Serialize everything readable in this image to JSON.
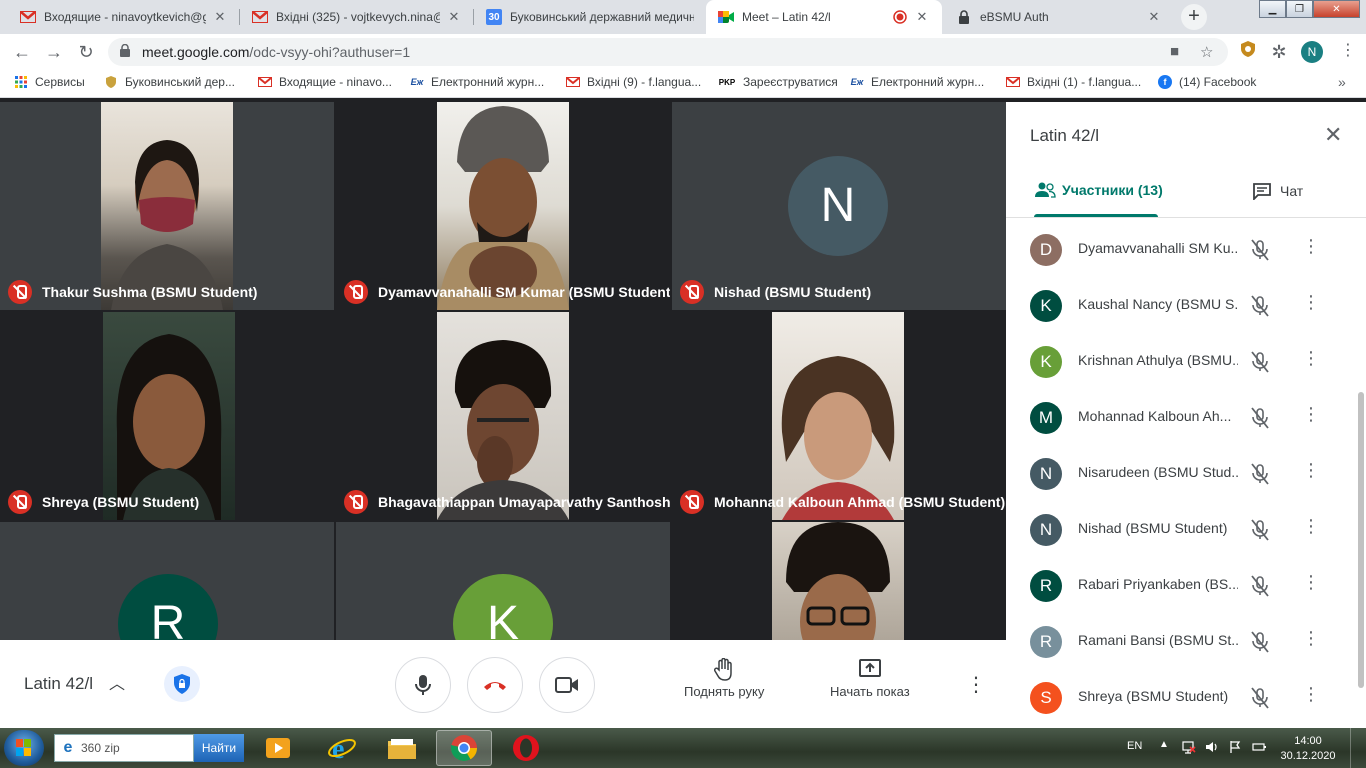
{
  "browser": {
    "tabs": [
      {
        "label": "Входящие - ninavoytkevich@gmail.com",
        "icon": "gmail-icon",
        "active": false
      },
      {
        "label": "Вхідні (325) - vojtkevych.nina@bsmu",
        "icon": "gmail-icon",
        "active": false
      },
      {
        "label": "Буковинський державний медичний",
        "icon": "calendar-icon",
        "active": false
      },
      {
        "label": "Meet – Latin 42/l",
        "icon": "meet-icon",
        "active": true
      },
      {
        "label": "eBSMU Auth",
        "icon": "lock-icon",
        "active": false
      }
    ],
    "url_host": "meet.google.com",
    "url_path": "/odc-vsyy-ohi?authuser=1",
    "profile_initial": "N",
    "bookmarks": [
      {
        "label": "Сервисы",
        "icon": "apps-grid-icon"
      },
      {
        "label": "Буковинський дер...",
        "icon": "university-crest-icon"
      },
      {
        "label": "Входящие - ninavo...",
        "icon": "gmail-icon"
      },
      {
        "label": "Електронний журн...",
        "icon": "ej-icon"
      },
      {
        "label": "Вхідні (9) - f.langua...",
        "icon": "gmail-icon"
      },
      {
        "label": "Зареєструватися",
        "icon": "pkp-icon"
      },
      {
        "label": "Електронний журн...",
        "icon": "ej-icon"
      },
      {
        "label": "Вхідні (1) - f.langua...",
        "icon": "gmail-icon"
      },
      {
        "label": "(14) Facebook",
        "icon": "facebook-icon"
      }
    ],
    "ej_glyph": "Еж",
    "pkp_glyph": "PKP"
  },
  "tiles": [
    {
      "name": "Thakur Sushma (BSMU Student)",
      "type": "video"
    },
    {
      "name": "Dyamavvanahalli SM Kumar (BSMU Student)",
      "type": "video"
    },
    {
      "name": "Nishad (BSMU Student)",
      "type": "avatar",
      "initial": "N",
      "color": "#455a64"
    },
    {
      "name": "Shreya (BSMU Student)",
      "type": "video"
    },
    {
      "name": "Bhagavathiappan Umayaparvathy Santhosh ...",
      "type": "video"
    },
    {
      "name": "Mohannad Kalboun Ahmad (BSMU Student)",
      "type": "video"
    },
    {
      "name": "",
      "type": "avatar",
      "initial": "R",
      "color": "#004d40"
    },
    {
      "name": "",
      "type": "avatar",
      "initial": "K",
      "color": "#689f38"
    },
    {
      "name": "",
      "type": "video"
    }
  ],
  "controls": {
    "meeting_title": "Latin 42/l",
    "raise_hand": "Поднять руку",
    "present": "Начать показ"
  },
  "panel": {
    "title": "Latin 42/l",
    "people_tab": "Участники (13)",
    "chat_tab": "Чат",
    "participants": [
      {
        "initial": "D",
        "name": "Dyamavvanahalli SM Ku...",
        "color": "#8d6e63"
      },
      {
        "initial": "K",
        "name": "Kaushal Nancy (BSMU S...",
        "color": "#004d40"
      },
      {
        "initial": "K",
        "name": "Krishnan Athulya (BSMU...",
        "color": "#689f38"
      },
      {
        "initial": "M",
        "name": "Mohannad Kalboun Ah...",
        "color": "#004d40"
      },
      {
        "initial": "N",
        "name": "Nisarudeen (BSMU Stud...",
        "color": "#455a64"
      },
      {
        "initial": "N",
        "name": "Nishad (BSMU Student)",
        "color": "#455a64"
      },
      {
        "initial": "R",
        "name": "Rabari Priyankaben (BS...",
        "color": "#004d40"
      },
      {
        "initial": "R",
        "name": "Ramani Bansi (BSMU St...",
        "color": "#78909c"
      },
      {
        "initial": "S",
        "name": "Shreya (BSMU Student)",
        "color": "#f4511e"
      }
    ]
  },
  "taskbar": {
    "search_value": "360 zip",
    "search_button": "Найти",
    "language": "EN",
    "time": "14:00",
    "date": "30.12.2020"
  }
}
